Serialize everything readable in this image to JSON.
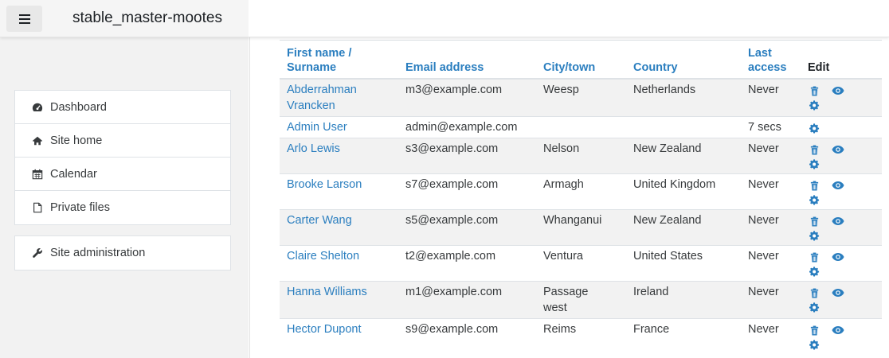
{
  "header": {
    "site_name": "stable_master-mootes"
  },
  "nav": {
    "items": [
      {
        "label": "Dashboard",
        "icon": "dashboard-icon"
      },
      {
        "label": "Site home",
        "icon": "home-icon"
      },
      {
        "label": "Calendar",
        "icon": "calendar-icon"
      },
      {
        "label": "Private files",
        "icon": "file-icon"
      }
    ],
    "admin": {
      "label": "Site administration",
      "icon": "wrench-icon"
    }
  },
  "table": {
    "headers": {
      "name_first": "First name",
      "name_sep": " /",
      "name_last": "Surname",
      "email": "Email address",
      "city": "City/town",
      "country": "Country",
      "access_1": "Last",
      "access_2": "access",
      "edit": "Edit"
    },
    "rows": [
      {
        "name1": "Abderrahman",
        "name2": "Vrancken",
        "email": "m3@example.com",
        "city1": "Weesp",
        "city2": "",
        "country": "Netherlands",
        "access": "Never"
      },
      {
        "name1": "Admin User",
        "name2": "",
        "email": "admin@example.com",
        "city1": "",
        "city2": "",
        "country": "",
        "access": "7 secs"
      },
      {
        "name1": "Arlo Lewis",
        "name2": "",
        "email": "s3@example.com",
        "city1": "Nelson",
        "city2": "",
        "country": "New Zealand",
        "access": "Never"
      },
      {
        "name1": "Brooke Larson",
        "name2": "",
        "email": "s7@example.com",
        "city1": "Armagh",
        "city2": "",
        "country": "United Kingdom",
        "access": "Never"
      },
      {
        "name1": "Carter Wang",
        "name2": "",
        "email": "s5@example.com",
        "city1": "Whanganui",
        "city2": "",
        "country": "New Zealand",
        "access": "Never"
      },
      {
        "name1": "Claire Shelton",
        "name2": "",
        "email": "t2@example.com",
        "city1": "Ventura",
        "city2": "",
        "country": "United States",
        "access": "Never"
      },
      {
        "name1": "Hanna Williams",
        "name2": "",
        "email": "m1@example.com",
        "city1": "Passage",
        "city2": "west",
        "country": "Ireland",
        "access": "Never"
      },
      {
        "name1": "Hector Dupont",
        "name2": "",
        "email": "s9@example.com",
        "city1": "Reims",
        "city2": "",
        "country": "France",
        "access": "Never"
      }
    ]
  },
  "colors": {
    "link": "#2a7ebf",
    "stripe": "#f2f2f2",
    "drawer": "#f2f2f2"
  }
}
